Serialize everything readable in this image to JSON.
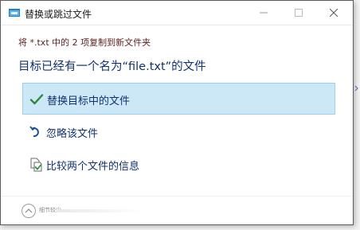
{
  "window": {
    "title": "替换或跳过文件",
    "accent_color": "#0078d7"
  },
  "dialog": {
    "subtitle": "将 *.txt 中的 2 项复制到新文件夹",
    "heading": "目标已经有一个名为“file.txt”的文件",
    "options": [
      {
        "label": "替换目标中的文件",
        "icon": "check-icon",
        "selected": true
      },
      {
        "label": "忽略该文件",
        "icon": "skip-arrow-icon",
        "selected": false
      },
      {
        "label": "比较两个文件的信息",
        "icon": "compare-files-icon",
        "selected": false
      }
    ],
    "details_toggle": "细节较少"
  },
  "colors": {
    "selected_bg": "#cce8f6",
    "selected_border": "#99d1ef",
    "heading_text": "#12326e",
    "subtitle_text": "#5a1f1f",
    "check_green": "#2a8a3c"
  }
}
